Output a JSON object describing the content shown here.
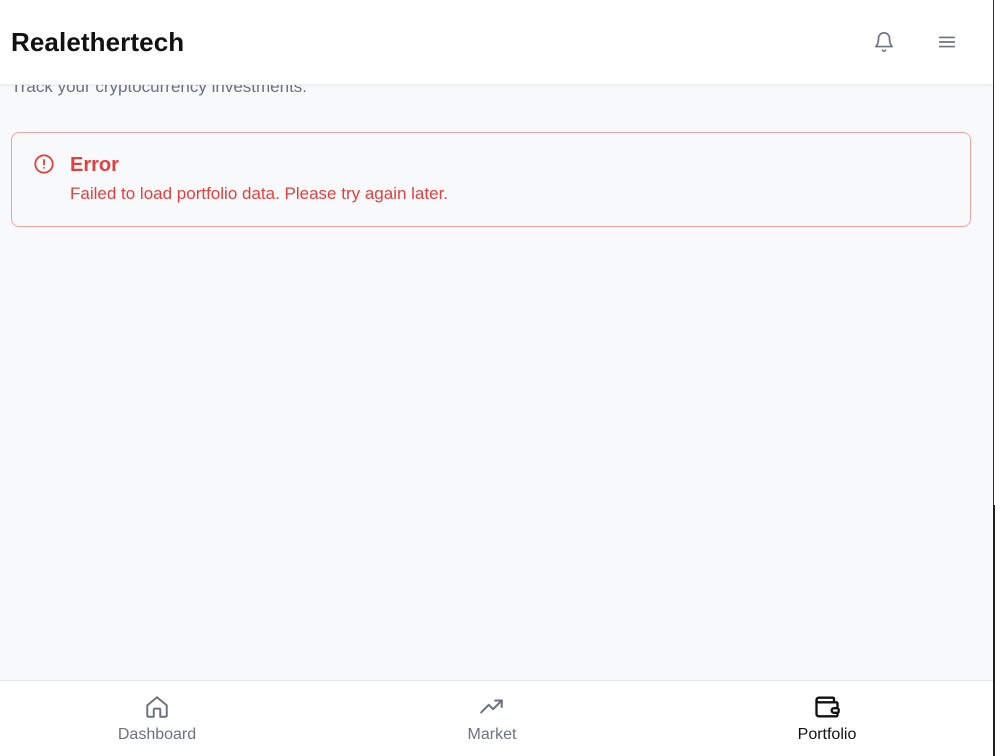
{
  "header": {
    "brand": "Realethertech",
    "bell_icon": "bell-icon",
    "menu_icon": "hamburger-menu-icon"
  },
  "page": {
    "subtitle": "Track your cryptocurrency investments."
  },
  "error": {
    "icon": "alert-circle-icon",
    "title": "Error",
    "message": "Failed to load portfolio data. Please try again later.",
    "color": "#e0413f",
    "border_color": "#f1a2a2"
  },
  "bottom_nav": {
    "items": [
      {
        "label": "Dashboard",
        "icon": "home-icon",
        "active": false
      },
      {
        "label": "Market",
        "icon": "trending-up-icon",
        "active": false
      },
      {
        "label": "Portfolio",
        "icon": "wallet-icon",
        "active": true
      }
    ]
  },
  "colors": {
    "background": "#f8f9fb",
    "muted_text": "#6b7280",
    "active_text": "#111111"
  }
}
